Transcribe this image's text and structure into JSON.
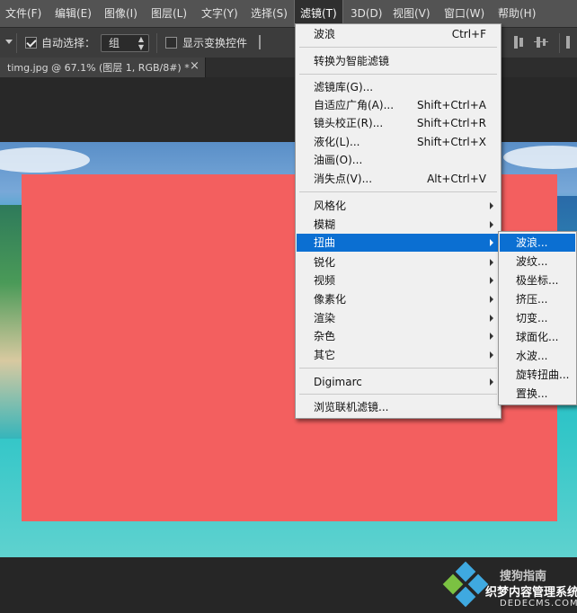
{
  "menubar": {
    "items": [
      "文件(F)",
      "编辑(E)",
      "图像(I)",
      "图层(L)",
      "文字(Y)",
      "选择(S)",
      "滤镜(T)",
      "3D(D)",
      "视图(V)",
      "窗口(W)",
      "帮助(H)"
    ],
    "open_index": 6
  },
  "options": {
    "auto_select_label": "自动选择：",
    "auto_select_checked": true,
    "group_value": "组",
    "show_transform_label": "显示变换控件",
    "show_transform_checked": false
  },
  "document_tab": {
    "title": "timg.jpg @ 67.1% (图层 1, RGB/8#) *",
    "close": "×"
  },
  "filter_menu": {
    "items": [
      {
        "label": "波浪",
        "shortcut": "Ctrl+F"
      },
      {
        "label": "转换为智能滤镜",
        "shortcut": ""
      },
      {
        "label": "滤镜库(G)...",
        "shortcut": ""
      },
      {
        "label": "自适应广角(A)...",
        "shortcut": "Shift+Ctrl+A"
      },
      {
        "label": "镜头校正(R)...",
        "shortcut": "Shift+Ctrl+R"
      },
      {
        "label": "液化(L)...",
        "shortcut": "Shift+Ctrl+X"
      },
      {
        "label": "油画(O)...",
        "shortcut": ""
      },
      {
        "label": "消失点(V)...",
        "shortcut": "Alt+Ctrl+V"
      },
      {
        "label": "风格化",
        "submenu": true
      },
      {
        "label": "模糊",
        "submenu": true
      },
      {
        "label": "扭曲",
        "submenu": true,
        "highlighted": true
      },
      {
        "label": "锐化",
        "submenu": true
      },
      {
        "label": "视频",
        "submenu": true
      },
      {
        "label": "像素化",
        "submenu": true
      },
      {
        "label": "渲染",
        "submenu": true
      },
      {
        "label": "杂色",
        "submenu": true
      },
      {
        "label": "其它",
        "submenu": true
      },
      {
        "label": "Digimarc",
        "submenu": true
      },
      {
        "label": "浏览联机滤镜...",
        "shortcut": ""
      }
    ]
  },
  "distort_submenu": {
    "items": [
      "波浪...",
      "波纹...",
      "极坐标...",
      "挤压...",
      "切变...",
      "球面化...",
      "水波...",
      "旋转扭曲...",
      "置换..."
    ],
    "highlighted_index": 0
  },
  "watermark": {
    "site": "搜狗指南",
    "caption": "织梦内容管理系统",
    "domain": "DEDECMS.COM"
  },
  "colors": {
    "menubar_bg": "#535353",
    "overlay_red": "#f35f5f",
    "highlight_blue": "#0b6fd2",
    "menu_bg": "#f0f0f0"
  }
}
